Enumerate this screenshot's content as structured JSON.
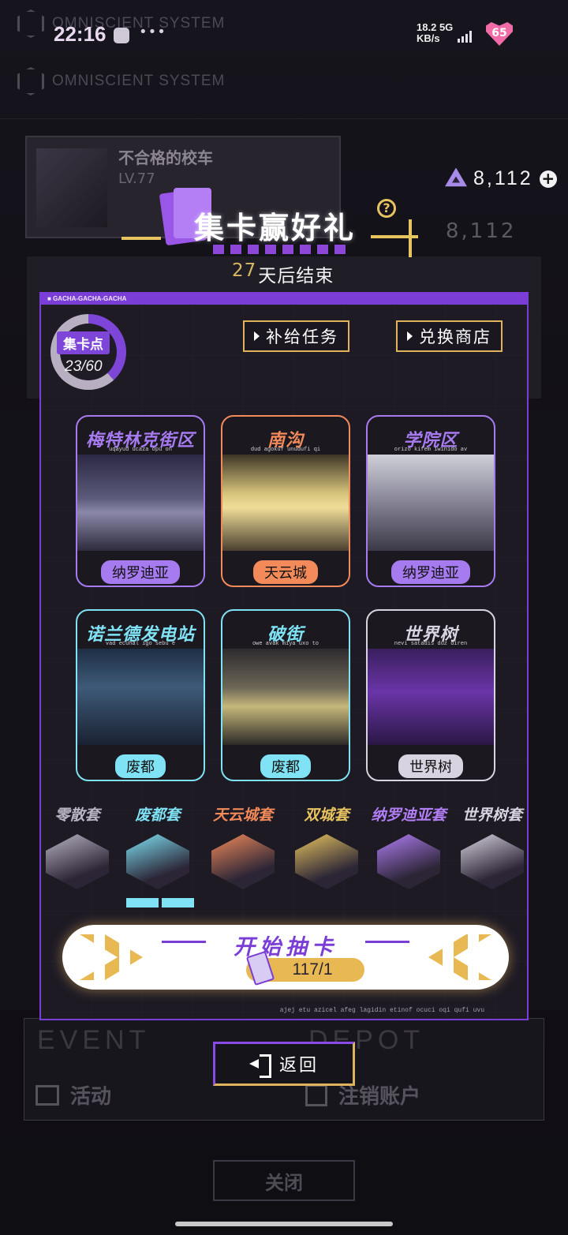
{
  "status_bar": {
    "time": "22:16",
    "more": "•••",
    "net_speed": "18.2",
    "net_unit": "KB/s",
    "net_type": "5G",
    "battery": "65"
  },
  "background": {
    "logo_text": "OMNISCIENT SYSTEM",
    "profile_name": "不合格的校车",
    "profile_level": "LV.77",
    "event_label": "EVENT",
    "depot_label": "DEPOT",
    "activity_label": "活动",
    "logout_label": "注销账户",
    "close_label": "关闭"
  },
  "currency": {
    "icon": "diamond-gem-icon",
    "value": "8,112",
    "add_icon": "plus-circle-icon"
  },
  "banner": {
    "title": "集卡赢好礼",
    "help_icon": "question-icon",
    "countdown_number": "27",
    "countdown_suffix": "天后结束"
  },
  "panel": {
    "header_text": "GACHA-GACHA-GACHA",
    "points_label": "集卡点",
    "points_value": "23/60",
    "points_current": 23,
    "points_max": 60,
    "supply_button": "补给任务",
    "shop_button": "兑换商店",
    "footnote": "ajej etu azicel afeg lagidin etinof ocuci oqi qufi uvu"
  },
  "districts": [
    {
      "name": "梅特林克街区",
      "sub": "uqayud ucaza opu on",
      "tag": "纳罗迪亚",
      "accent": "#a77bf0",
      "tag_bg": "#a77bf0"
    },
    {
      "name": "南沟",
      "sub": "dud agokuf unudufi qi",
      "tag": "天云城",
      "accent": "#f28a5a",
      "tag_bg": "#f28a5a"
    },
    {
      "name": "学院区",
      "sub": "orizo kifem iwinido av",
      "tag": "纳罗迪亚",
      "accent": "#a77bf0",
      "tag_bg": "#a77bf0"
    },
    {
      "name": "诺兰德发电站",
      "sub": "vad ecuhal igo sebu e",
      "tag": "废都",
      "accent": "#7fe3f5",
      "tag_bg": "#7fe3f5"
    },
    {
      "name": "破街",
      "sub": "owe avak miya uxo to",
      "tag": "废都",
      "accent": "#7fe3f5",
      "tag_bg": "#7fe3f5"
    },
    {
      "name": "世界树",
      "sub": "nevi satadis duz diren",
      "tag": "世界树",
      "accent": "#d8d3e0",
      "tag_bg": "#d8d3e0"
    }
  ],
  "sets": [
    {
      "name": "零散套",
      "color": "#b9b4c2",
      "icon": "scatter-set-icon"
    },
    {
      "name": "废都套",
      "color": "#7fe3f5",
      "icon": "ruin-city-set-icon"
    },
    {
      "name": "天云城套",
      "color": "#f28a5a",
      "icon": "sky-city-set-icon"
    },
    {
      "name": "双城套",
      "color": "#e8c460",
      "icon": "twin-city-set-icon"
    },
    {
      "name": "纳罗迪亚套",
      "color": "#b27ef5",
      "icon": "narodia-set-icon"
    },
    {
      "name": "世界树套",
      "color": "#d8d3e0",
      "icon": "world-tree-set-icon"
    }
  ],
  "draw_button": {
    "label": "开始抽卡",
    "cost": "117/1",
    "ticket_icon": "gacha-ticket-icon"
  },
  "back_button": {
    "label": "返回",
    "icon": "exit-arrow-icon"
  }
}
